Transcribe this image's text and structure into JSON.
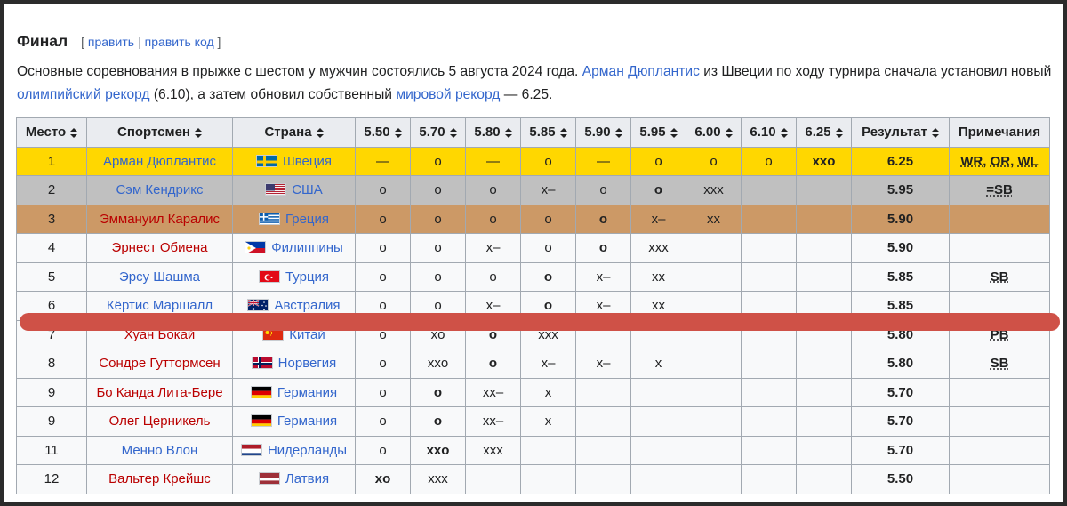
{
  "heading": {
    "title": "Финал",
    "edit_open": "[",
    "edit_label": "править",
    "edit_sep": "|",
    "edit_code_label": "править код",
    "edit_close": "]"
  },
  "intro": {
    "text_1": "Основные соревнования в прыжке с шестом у мужчин состоялись 5 августа 2024 года. ",
    "link_athlete": "Арман Дюплантис",
    "text_2": " из Швеции по ходу турнира сначала установил новый ",
    "link_or": "олимпийский рекорд",
    "text_3": " (6.10), а затем обновил собственный ",
    "link_wr": "мировой рекорд",
    "text_4": " — 6.25."
  },
  "table": {
    "headers": [
      "Место",
      "Спортсмен",
      "Страна",
      "5.50",
      "5.70",
      "5.80",
      "5.85",
      "5.90",
      "5.95",
      "6.00",
      "6.10",
      "6.25",
      "Результат",
      "Примечания"
    ],
    "rows": [
      {
        "place": "1",
        "name": "Арман Дюплантис",
        "country": "Швеция",
        "attempts": [
          "—",
          "o",
          "—",
          "o",
          "—",
          "o",
          "o",
          "o",
          "xxo"
        ],
        "result": "6.25",
        "notes": [
          "WR",
          ", ",
          "OR",
          ", ",
          "WL"
        ]
      },
      {
        "place": "2",
        "name": "Сэм Кендрикс",
        "country": "США",
        "attempts": [
          "o",
          "o",
          "o",
          "x–",
          "o",
          "o",
          "xxx",
          "",
          ""
        ],
        "result": "5.95",
        "notes": [
          "=SB"
        ]
      },
      {
        "place": "3",
        "name": "Эммануил Каралис",
        "country": "Греция",
        "attempts": [
          "o",
          "o",
          "o",
          "o",
          "o",
          "x–",
          "xx",
          "",
          ""
        ],
        "result": "5.90",
        "notes": [
          ""
        ]
      },
      {
        "place": "4",
        "name": "Эрнест Обиена",
        "country": "Филиппины",
        "attempts": [
          "o",
          "o",
          "x–",
          "o",
          "o",
          "xxx",
          "",
          "",
          ""
        ],
        "result": "5.90",
        "notes": [
          ""
        ]
      },
      {
        "place": "5",
        "name": "Эрсу Шашма",
        "country": "Турция",
        "attempts": [
          "o",
          "o",
          "o",
          "o",
          "x–",
          "xx",
          "",
          "",
          ""
        ],
        "result": "5.85",
        "notes": [
          "SB"
        ]
      },
      {
        "place": "6",
        "name": "Кёртис Маршалл",
        "country": "Австралия",
        "attempts": [
          "o",
          "o",
          "x–",
          "o",
          "x–",
          "xx",
          "",
          "",
          ""
        ],
        "result": "5.85",
        "notes": [
          ""
        ]
      },
      {
        "place": "7",
        "name": "Хуан Бокай",
        "country": "Китай",
        "attempts": [
          "o",
          "xo",
          "o",
          "xxx",
          "",
          "",
          "",
          "",
          ""
        ],
        "result": "5.80",
        "notes": [
          "PB"
        ]
      },
      {
        "place": "8",
        "name": "Сондре Гуттормсен",
        "country": "Норвегия",
        "attempts": [
          "o",
          "xxo",
          "o",
          "x–",
          "x–",
          "x",
          "",
          "",
          ""
        ],
        "result": "5.80",
        "notes": [
          "SB"
        ]
      },
      {
        "place": "9",
        "name": "Бо Канда Лита-Бере",
        "country": "Германия",
        "attempts": [
          "o",
          "o",
          "xx–",
          "x",
          "",
          "",
          "",
          "",
          ""
        ],
        "result": "5.70",
        "notes": [
          ""
        ]
      },
      {
        "place": "9",
        "name": "Олег Церникель",
        "country": "Германия",
        "attempts": [
          "o",
          "o",
          "xx–",
          "x",
          "",
          "",
          "",
          "",
          ""
        ],
        "result": "5.70",
        "notes": [
          ""
        ]
      },
      {
        "place": "11",
        "name": "Менно Влон",
        "country": "Нидерланды",
        "attempts": [
          "o",
          "xxo",
          "xxx",
          "",
          "",
          "",
          "",
          "",
          ""
        ],
        "result": "5.70",
        "notes": [
          ""
        ]
      },
      {
        "place": "12",
        "name": "Вальтер Крейшс",
        "country": "Латвия",
        "attempts": [
          "xo",
          "xxx",
          "",
          "",
          "",
          "",
          "",
          "",
          ""
        ],
        "result": "5.50",
        "notes": [
          ""
        ]
      }
    ]
  },
  "style": {
    "row_classes": [
      "gold",
      "silver",
      "bronze",
      "plain",
      "plain",
      "plain",
      "plain",
      "plain",
      "plain",
      "plain",
      "plain",
      "plain"
    ],
    "name_colors": [
      "blue",
      "blue",
      "red",
      "red",
      "blue",
      "blue",
      "red",
      "red",
      "red",
      "red",
      "blue",
      "red"
    ],
    "bold_attempts": [
      [
        0,
        0,
        0,
        0,
        0,
        0,
        0,
        0,
        1
      ],
      [
        0,
        0,
        0,
        0,
        0,
        1,
        0,
        0,
        0
      ],
      [
        0,
        0,
        0,
        0,
        1,
        0,
        0,
        0,
        0
      ],
      [
        0,
        0,
        0,
        0,
        1,
        0,
        0,
        0,
        0
      ],
      [
        0,
        0,
        0,
        1,
        0,
        0,
        0,
        0,
        0
      ],
      [
        0,
        0,
        0,
        1,
        0,
        0,
        0,
        0,
        0
      ],
      [
        0,
        0,
        1,
        0,
        0,
        0,
        0,
        0,
        0
      ],
      [
        0,
        0,
        1,
        0,
        0,
        0,
        0,
        0,
        0
      ],
      [
        0,
        1,
        0,
        0,
        0,
        0,
        0,
        0,
        0
      ],
      [
        0,
        1,
        0,
        0,
        0,
        0,
        0,
        0,
        0
      ],
      [
        0,
        1,
        0,
        0,
        0,
        0,
        0,
        0,
        0
      ],
      [
        1,
        0,
        0,
        0,
        0,
        0,
        0,
        0,
        0
      ]
    ],
    "flag_icons": [
      "sweden-flag-icon",
      "usa-flag-icon",
      "greece-flag-icon",
      "philippines-flag-icon",
      "turkey-flag-icon",
      "australia-flag-icon",
      "china-flag-icon",
      "norway-flag-icon",
      "germany-flag-icon",
      "germany-flag-icon",
      "netherlands-flag-icon",
      "latvia-flag-icon"
    ],
    "link_blue": "#3366cc",
    "link_red": "#ba0000",
    "highlight_stroke": "#cf5147"
  }
}
